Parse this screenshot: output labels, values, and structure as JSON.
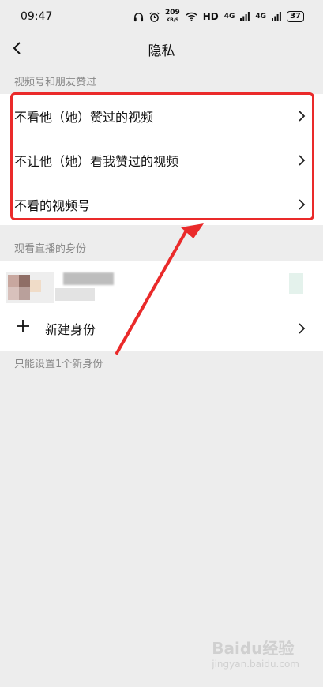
{
  "status_bar": {
    "time": "09:47",
    "speed_value": "209",
    "speed_unit": "KB/S",
    "hd_label": "HD",
    "signal1": "4G",
    "signal2": "4G",
    "battery": "37"
  },
  "header": {
    "title": "隐私"
  },
  "section1": {
    "label": "视频号和朋友赞过",
    "items": [
      {
        "label": "不看他（她）赞过的视频"
      },
      {
        "label": "不让他（她）看我赞过的视频"
      },
      {
        "label": "不看的视频号"
      }
    ]
  },
  "section2": {
    "label": "观看直播的身份",
    "new_identity_label": "新建身份",
    "note": "只能设置1个新身份"
  },
  "annotation": {
    "highlight_color": "#ea2a2a"
  },
  "watermark": {
    "text": "Baidu经验",
    "sub": "jingyan.baidu.com"
  }
}
